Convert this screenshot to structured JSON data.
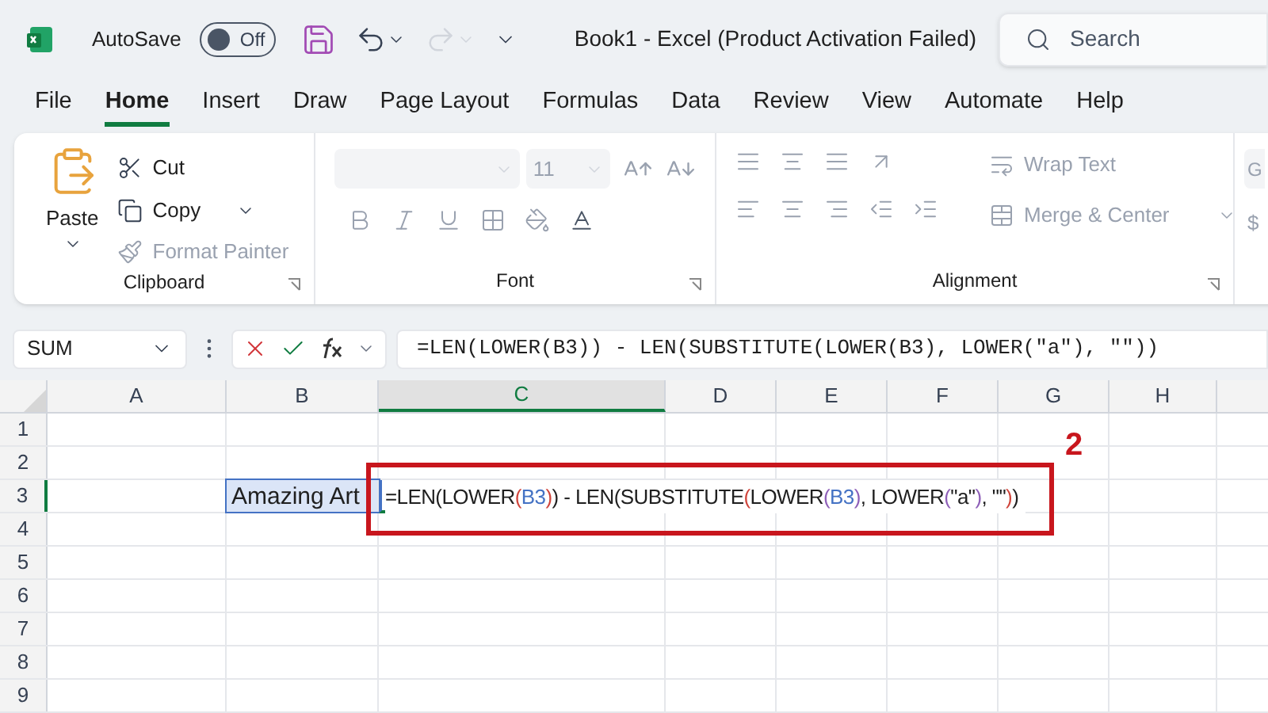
{
  "titlebar": {
    "autosave_label": "AutoSave",
    "autosave_on": false,
    "autosave_state": "Off",
    "title": "Book1  -  Excel (Product Activation Failed)",
    "search": {
      "placeholder": "Search"
    }
  },
  "tabs": [
    {
      "label": "File",
      "selected": false
    },
    {
      "label": "Home",
      "selected": true
    },
    {
      "label": "Insert",
      "selected": false
    },
    {
      "label": "Draw",
      "selected": false
    },
    {
      "label": "Page Layout",
      "selected": false
    },
    {
      "label": "Formulas",
      "selected": false
    },
    {
      "label": "Data",
      "selected": false
    },
    {
      "label": "Review",
      "selected": false
    },
    {
      "label": "View",
      "selected": false
    },
    {
      "label": "Automate",
      "selected": false
    },
    {
      "label": "Help",
      "selected": false
    }
  ],
  "ribbon": {
    "clipboard": {
      "label": "Clipboard",
      "paste": "Paste",
      "cut": "Cut",
      "copy": "Copy",
      "format_painter": "Format Painter",
      "format_painter_disabled": true
    },
    "font": {
      "label": "Font",
      "size": "11"
    },
    "alignment": {
      "label": "Alignment",
      "wrap_text": "Wrap Text",
      "merge_center": "Merge & Center"
    },
    "number": {
      "format": "G",
      "currency": "$"
    }
  },
  "formula_bar": {
    "name_box": "SUM",
    "formula": "=LEN(LOWER(B3)) - LEN(SUBSTITUTE(LOWER(B3), LOWER(\"a\"), \"\"))"
  },
  "sheet": {
    "columns": [
      {
        "label": "A",
        "selected": false
      },
      {
        "label": "B",
        "selected": false
      },
      {
        "label": "C",
        "selected": true
      },
      {
        "label": "D",
        "selected": false
      },
      {
        "label": "E",
        "selected": false
      },
      {
        "label": "F",
        "selected": false
      },
      {
        "label": "G",
        "selected": false
      },
      {
        "label": "H",
        "selected": false
      }
    ],
    "rows": [
      {
        "label": "1",
        "selected": false
      },
      {
        "label": "2",
        "selected": false
      },
      {
        "label": "3",
        "selected": true
      },
      {
        "label": "4",
        "selected": false
      },
      {
        "label": "5",
        "selected": false
      },
      {
        "label": "6",
        "selected": false
      },
      {
        "label": "7",
        "selected": false
      },
      {
        "label": "8",
        "selected": false
      },
      {
        "label": "9",
        "selected": false
      }
    ],
    "b3": "Amazing Art",
    "c3_segments": [
      {
        "text": "=LEN(LOWER",
        "color": "#1f1f1f"
      },
      {
        "text": "(",
        "color": "#d0453c"
      },
      {
        "text": "B3",
        "color": "#4472c4"
      },
      {
        "text": ")",
        "color": "#d0453c"
      },
      {
        "text": ") - LEN(SUBSTITUTE",
        "color": "#1f1f1f"
      },
      {
        "text": "(",
        "color": "#d0453c"
      },
      {
        "text": "LOWER",
        "color": "#1f1f1f"
      },
      {
        "text": "(",
        "color": "#8e5fb8"
      },
      {
        "text": "B3",
        "color": "#4472c4"
      },
      {
        "text": ")",
        "color": "#8e5fb8"
      },
      {
        "text": ", LOWER",
        "color": "#1f1f1f"
      },
      {
        "text": "(",
        "color": "#8e5fb8"
      },
      {
        "text": "\"a\"",
        "color": "#1f1f1f"
      },
      {
        "text": ")",
        "color": "#8e5fb8"
      },
      {
        "text": ", \"\"",
        "color": "#1f1f1f"
      },
      {
        "text": ")",
        "color": "#d0453c"
      },
      {
        "text": ")",
        "color": "#1f1f1f"
      }
    ]
  },
  "annotation": {
    "label": "2"
  }
}
